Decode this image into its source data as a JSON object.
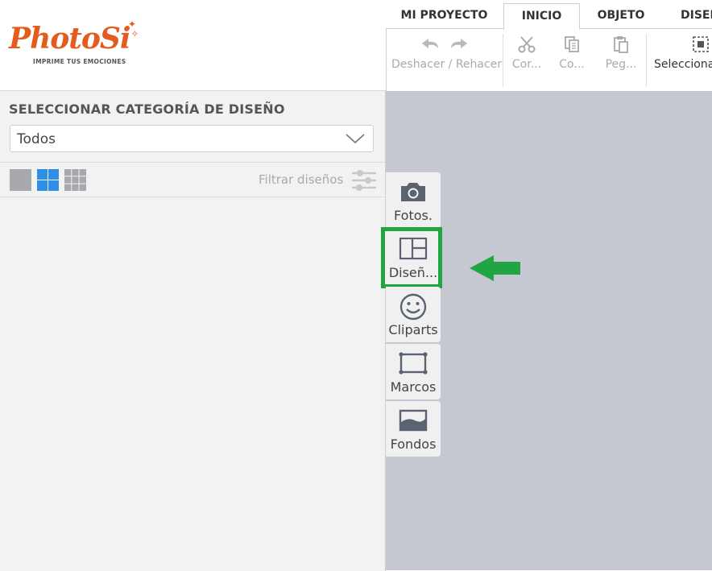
{
  "logo": {
    "brand": "PhotoSi",
    "tagline": "IMPRIME TUS EMOCIONES"
  },
  "tabs": [
    "MI PROYECTO",
    "INICIO",
    "OBJETO",
    "DISEÑ"
  ],
  "toolbar": {
    "undo_redo_label": "Deshacer / Rehacer",
    "cut_label": "Cor...",
    "copy_label": "Co...",
    "paste_label": "Peg...",
    "select_label": "Selecciona"
  },
  "panel": {
    "title": "SELECCIONAR CATEGORÍA DE DISEÑO",
    "category_select": "Todos",
    "filter_label": "Filtrar diseños"
  },
  "side_tools": [
    {
      "label": "Fotos.",
      "icon": "camera-icon"
    },
    {
      "label": "Diseñ...",
      "icon": "layout-icon"
    },
    {
      "label": "Cliparts",
      "icon": "smiley-icon"
    },
    {
      "label": "Marcos",
      "icon": "frame-icon"
    },
    {
      "label": "Fondos",
      "icon": "background-icon"
    }
  ],
  "colors": {
    "brand": "#e35c1e",
    "highlight": "#21a443",
    "canvas": "#c5c8d0",
    "grid_active": "#2f8fe6"
  }
}
